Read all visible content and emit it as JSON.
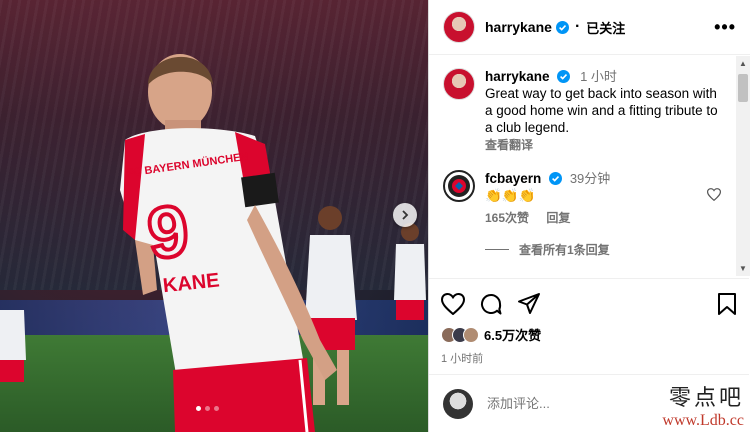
{
  "header": {
    "username": "harrykane",
    "follow_status": "已关注",
    "more": "•••"
  },
  "caption": {
    "username": "harrykane",
    "time": "1 小时",
    "text": "Great way to get back into season with a good home win and a fitting tribute to a club legend.",
    "translate": "查看翻译"
  },
  "comment": {
    "username": "fcbayern",
    "time": "39分钟",
    "text": "👏👏👏",
    "likes": "165次赞",
    "reply": "回复",
    "view_replies": "查看所有1条回复"
  },
  "post": {
    "likes": "6.5万次赞",
    "time_ago": "1 小时前",
    "jersey_text": "FC BAYERN MÜNCHEN",
    "jersey_number": "9",
    "jersey_name": "KANE"
  },
  "add_comment": {
    "placeholder": "添加评论..."
  },
  "carousel": {
    "count": 3,
    "active": 0
  },
  "watermark": {
    "cn": "零点吧",
    "url": "www.Ldb.cc"
  },
  "colors": {
    "verified": "#0095f6",
    "bayern_red": "#dc052d",
    "muted": "#737373"
  }
}
